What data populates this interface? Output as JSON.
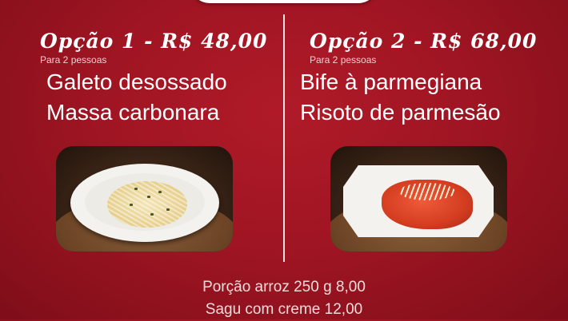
{
  "option1": {
    "title": "Opção 1 - R$ 48,00",
    "subtitle": "Para 2 pessoas",
    "dishes": [
      "Galeto desossado",
      "Massa carbonara"
    ],
    "photo_icon": "pasta-dish-photo"
  },
  "option2": {
    "title": "Opção 2 - R$ 68,00",
    "subtitle": "Para 2 pessoas",
    "dishes": [
      "Bife à parmegiana",
      "Risoto de parmesão"
    ],
    "photo_icon": "steak-parmigiana-photo"
  },
  "extras": [
    "Porção arroz 250 g 8,00",
    "Sagu com creme 12,00"
  ],
  "colors": {
    "background": "#a01523",
    "text": "#ffffff"
  }
}
